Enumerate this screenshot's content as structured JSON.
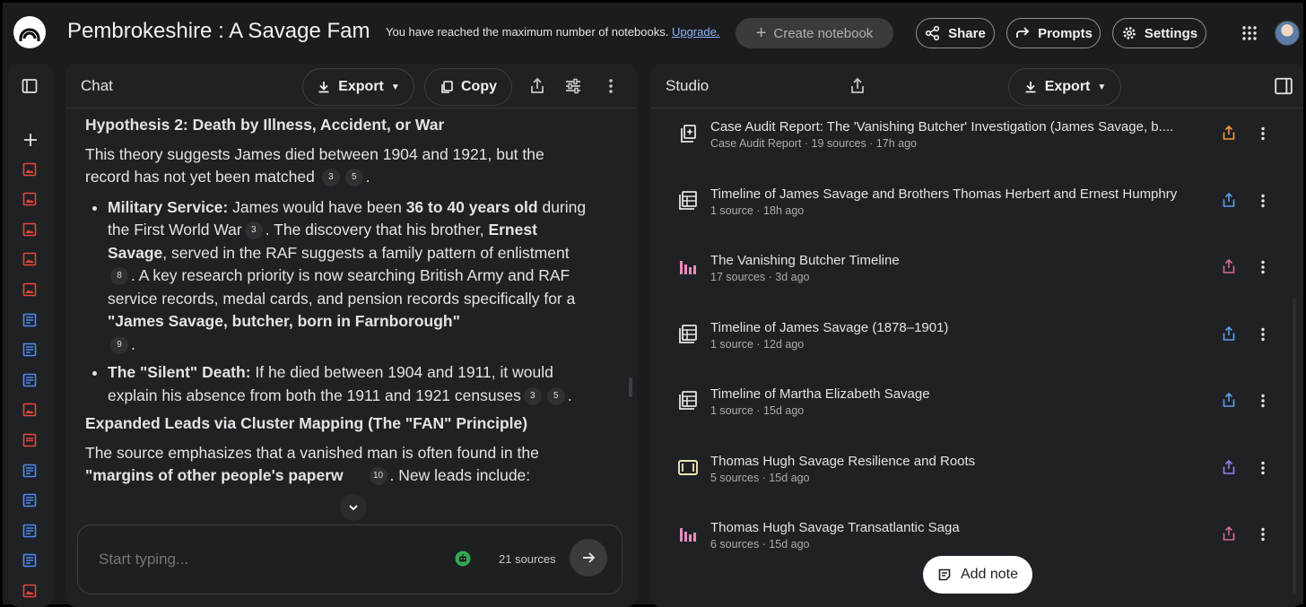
{
  "app": {
    "notebook_title": "Pembrokeshire : A Savage Family",
    "notice_text": "You have reached the maximum number of notebooks.",
    "notice_link": "Upgrade.",
    "create_notebook": "Create notebook",
    "share_label": "Share",
    "prompts_label": "Prompts",
    "settings_label": "Settings"
  },
  "sidebar_icons": [
    "plus-icon",
    "image-source-icon",
    "image-source-icon",
    "image-source-icon",
    "image-source-icon",
    "image-source-icon",
    "doc-source-icon",
    "doc-source-icon",
    "doc-source-icon",
    "image-source-icon",
    "pdf-source-icon",
    "doc-source-icon",
    "doc-source-icon",
    "doc-source-icon",
    "doc-source-icon",
    "image-source-icon"
  ],
  "chat": {
    "header": "Chat",
    "export_label": "Export",
    "copy_label": "Copy",
    "h1": "Hypothesis 2: Death by Illness, Accident, or War",
    "p1": "This theory suggests James died between 1904 and 1921, but the record has not yet been matched",
    "p1_cites": [
      "3",
      "5"
    ],
    "b1_label": "Military Service:",
    "b1_t1": " James would have been ",
    "b1_bold": "36 to 40 years old",
    "b1_t2": " during the First World War",
    "b1_c1": "3",
    "b1_t3": ". The discovery that his brother, ",
    "b1_name": "Ernest Savage",
    "b1_t4": ", served in the RAF suggests a family pattern of enlistment",
    "b1_c2": "8",
    "b1_t5": ". A key research priority is now searching British Army and RAF service records, medal cards, and pension records specifically for a ",
    "b1_quote": "\"James Savage, butcher, born in Farnborough\"",
    "b1_c3": "9",
    "b2_label": "The \"Silent\" Death:",
    "b2_t1": " If he died between 1904 and 1911, it would explain his absence from both the 1911 and 1921 censuses",
    "b2_cites": [
      "3",
      "5"
    ],
    "h2": "Expanded Leads via Cluster Mapping (The \"FAN\" Principle)",
    "p2_t1": "The source emphasizes that a vanished man is often found in the ",
    "p2_bold": "\"margins of other people's paperw",
    "p2_c1": "10",
    "p2_t2": ". New leads include:",
    "input_placeholder": "Start typing...",
    "sources_count": "21 sources"
  },
  "studio": {
    "header": "Studio",
    "export_label": "Export",
    "add_note": "Add note",
    "notes": [
      {
        "title": "Case Audit Report: The 'Vanishing Butcher' Investigation (James Savage, b....",
        "meta": "Case Audit Report · 19 sources · 17h ago",
        "icon": "report-icon",
        "share_color": "#f0a030"
      },
      {
        "title": "Timeline of James Savage and Brothers Thomas Herbert and Ernest Humphry",
        "meta": "1 source · 18h ago",
        "icon": "table-icon",
        "share_color": "#5a9cf0"
      },
      {
        "title": "The Vanishing Butcher Timeline",
        "meta": "17 sources · 3d ago",
        "icon": "bar-chart-icon",
        "share_color": "#d7679a"
      },
      {
        "title": "Timeline of James Savage (1878–1901)",
        "meta": "1 source · 12d ago",
        "icon": "table-icon",
        "share_color": "#5a9cf0"
      },
      {
        "title": "Timeline of Martha Elizabeth Savage",
        "meta": "1 source · 15d ago",
        "icon": "table-icon",
        "share_color": "#5a9cf0"
      },
      {
        "title": "Thomas Hugh Savage Resilience and Roots",
        "meta": "5 sources · 15d ago",
        "icon": "slides-icon",
        "share_color": "#9b7cf0"
      },
      {
        "title": "Thomas Hugh Savage Transatlantic Saga",
        "meta": "6 sources · 15d ago",
        "icon": "bar-chart-icon",
        "share_color": "#d7679a"
      }
    ]
  },
  "colors": {
    "source_image": "#e8453c",
    "source_doc": "#4c8bf5",
    "source_pdf": "#e8453c",
    "bar_chart": "#e88ac0",
    "slides": "#f5e6b3"
  }
}
